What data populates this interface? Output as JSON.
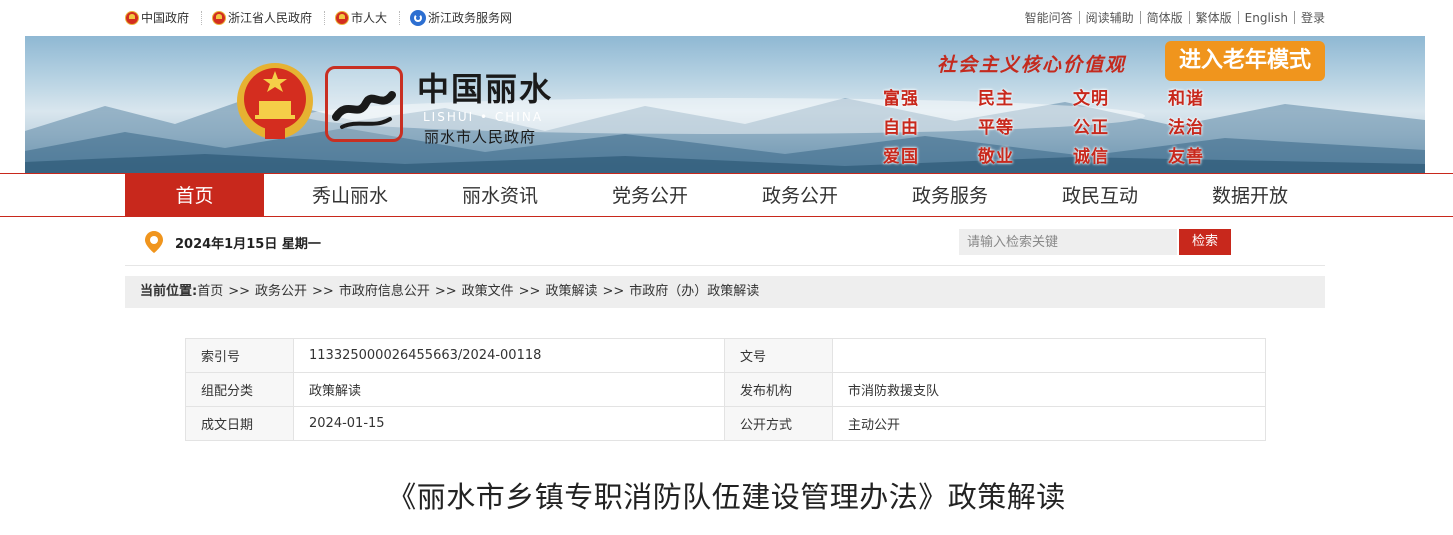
{
  "top_links": [
    {
      "label": "中国政府",
      "icon": "national-emblem-icon"
    },
    {
      "label": "浙江省人民政府",
      "icon": "national-emblem-icon"
    },
    {
      "label": "市人大",
      "icon": "national-emblem-icon"
    },
    {
      "label": "浙江政务服务网",
      "icon": "zjzw-logo-icon"
    }
  ],
  "right_links": [
    "智能问答",
    "阅读辅助",
    "简体版",
    "繁体版",
    "English",
    "登录"
  ],
  "banner": {
    "logo_title": "中国丽水",
    "logo_sub": "LISHUI • CHINA",
    "logo_name": "丽水市人民政府",
    "slogan": "社会主义核心价值观",
    "elder_mode": "进入老年模式",
    "values": [
      "富强",
      "民主",
      "文明",
      "和谐",
      "自由",
      "平等",
      "公正",
      "法治",
      "爱国",
      "敬业",
      "诚信",
      "友善"
    ],
    "accent_color": "#c8281c",
    "elder_color": "#f0951d"
  },
  "nav": [
    "首页",
    "秀山丽水",
    "丽水资讯",
    "党务公开",
    "政务公开",
    "政务服务",
    "政民互动",
    "数据开放"
  ],
  "date_text": "2024年1月15日 星期一",
  "search": {
    "placeholder": "请输入检索关键",
    "button": "检索"
  },
  "breadcrumb": {
    "label": "当前位置:",
    "items": [
      "首页",
      "政务公开",
      "市政府信息公开",
      "政策文件",
      "政策解读",
      "市政府（办）政策解读"
    ],
    "sep": ">>"
  },
  "meta": [
    [
      {
        "k": "索引号",
        "v": "113325000026455663/2024-00118"
      },
      {
        "k": "文号",
        "v": ""
      }
    ],
    [
      {
        "k": "组配分类",
        "v": "政策解读"
      },
      {
        "k": "发布机构",
        "v": "市消防救援支队"
      }
    ],
    [
      {
        "k": "成文日期",
        "v": "2024-01-15"
      },
      {
        "k": "公开方式",
        "v": "主动公开"
      }
    ]
  ],
  "article_title": "《丽水市乡镇专职消防队伍建设管理办法》政策解读"
}
